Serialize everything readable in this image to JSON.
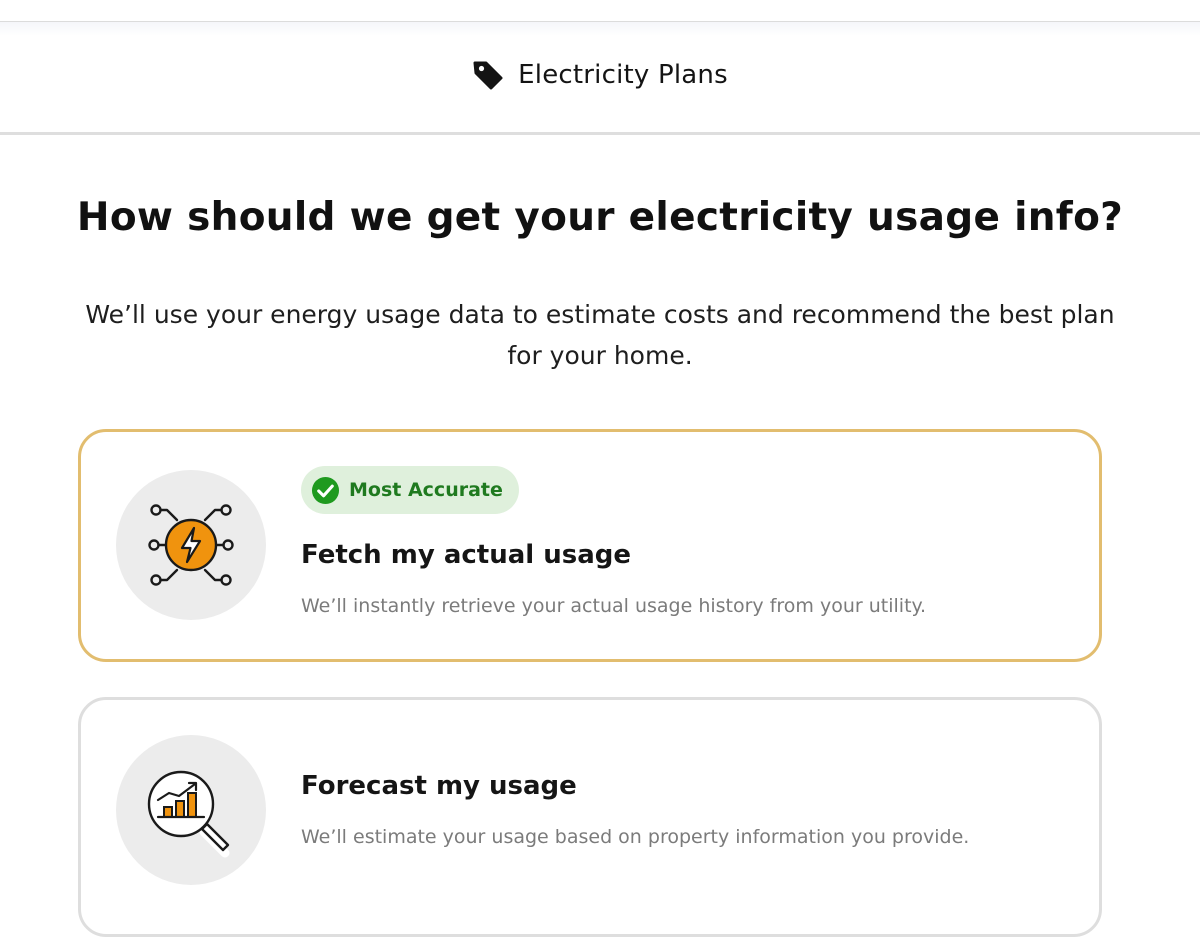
{
  "header": {
    "title": "Electricity Plans",
    "icon": "tag-icon"
  },
  "question": "How should we get your electricity usage info?",
  "subtext": "We’ll use your energy usage data to estimate costs and recommend the best plan for your home.",
  "options": [
    {
      "badge": "Most Accurate",
      "badge_icon": "check-circle-icon",
      "title": "Fetch my actual usage",
      "description": "We’ll instantly retrieve your actual usage history from your utility.",
      "icon": "lightning-network-icon",
      "highlighted": true
    },
    {
      "title": "Forecast my usage",
      "description": "We’ll estimate your usage based on property information you provide.",
      "icon": "chart-magnifier-icon",
      "highlighted": false
    }
  ],
  "colors": {
    "highlight_border": "#e2bd6f",
    "default_border": "#dedede",
    "accent_orange": "#f0930e",
    "badge_bg": "#dff0dc",
    "badge_green": "#1f9a1f"
  }
}
